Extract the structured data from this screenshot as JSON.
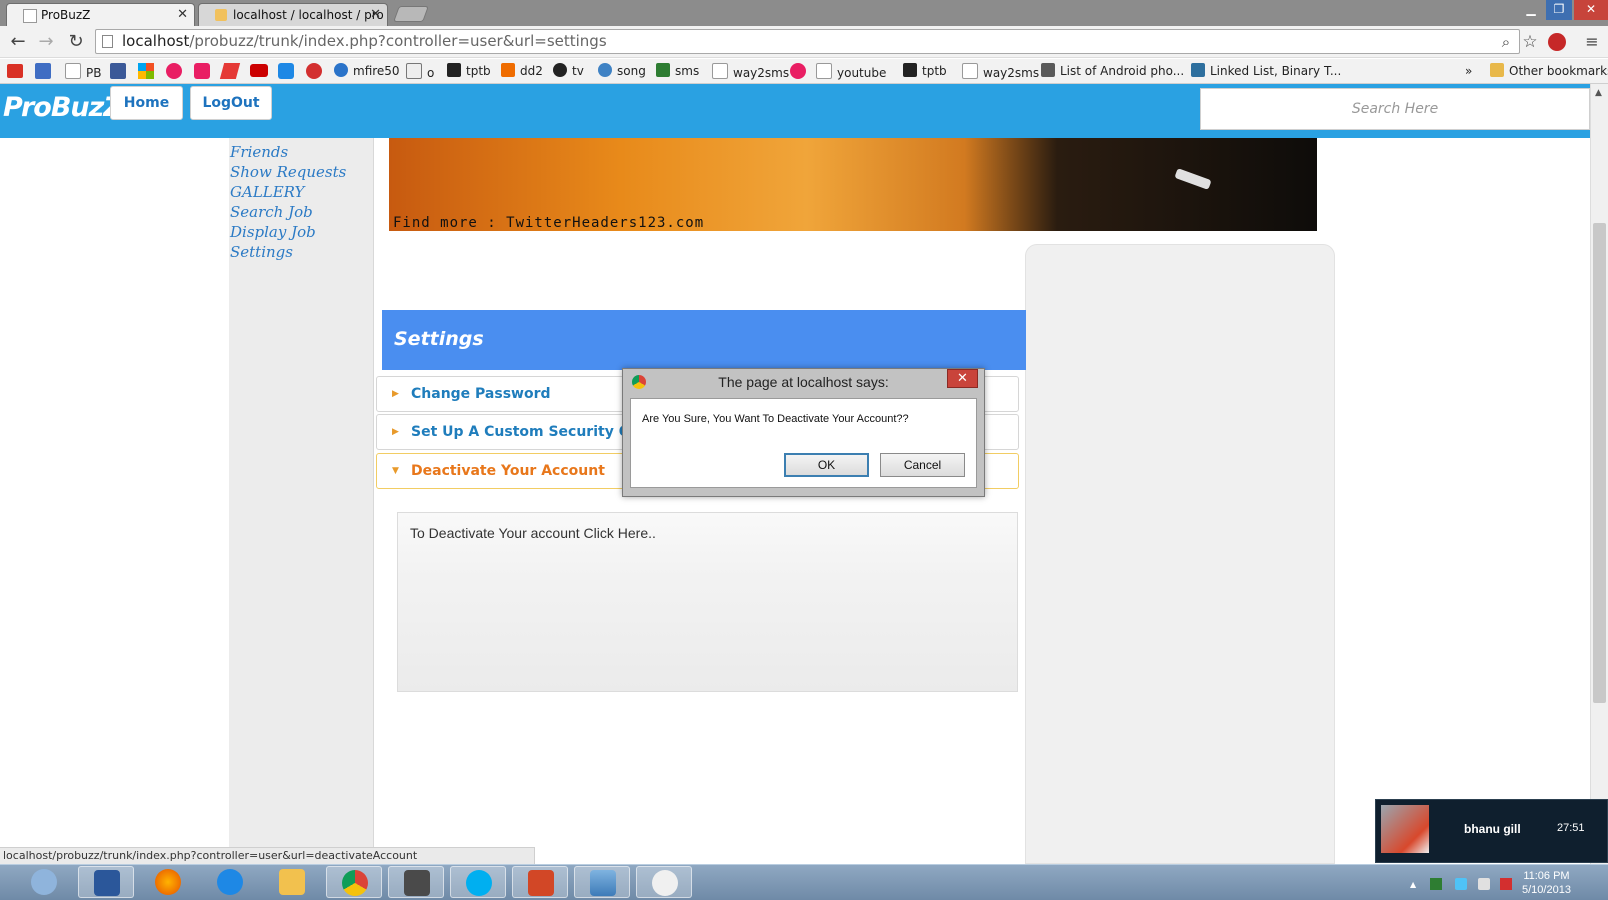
{
  "browser": {
    "tabs": [
      {
        "title": "ProBuzZ"
      },
      {
        "title": "localhost / localhost / pro"
      }
    ],
    "address": {
      "host": "localhost",
      "path": "/probuzz/trunk/index.php?controller=user&url=settings"
    },
    "status_url": "localhost/probuzz/trunk/index.php?controller=user&url=deactivateAccount",
    "bookmarks": [
      {
        "label": "PB",
        "color": "#9e9e9e"
      },
      {
        "label": "mfire50",
        "color": "#2a73c9"
      },
      {
        "label": "o",
        "color": "#777777"
      },
      {
        "label": "tptb",
        "color": "#222222"
      },
      {
        "label": "dd2",
        "color": "#ef6c00"
      },
      {
        "label": "tv",
        "color": "#222222"
      },
      {
        "label": "song",
        "color": "#3f82c4"
      },
      {
        "label": "sms",
        "color": "#2e7d32"
      },
      {
        "label": "way2sms",
        "color": "#9e9e9e"
      },
      {
        "label": "youtube",
        "color": "#9e9e9e"
      },
      {
        "label": "tptb",
        "color": "#222222"
      },
      {
        "label": "way2sms",
        "color": "#9e9e9e"
      },
      {
        "label": "List of Android pho...",
        "color": "#5a5a5a"
      },
      {
        "label": "Linked List, Binary T...",
        "color": "#2e6f9e"
      }
    ],
    "overflow": "»",
    "other_bookmarks": "Other bookmarks"
  },
  "site": {
    "logo": "ProBuzZ",
    "nav": {
      "home": "Home",
      "logout": "LogOut"
    },
    "search_placeholder": "Search Here",
    "sidebar": [
      "Friends",
      "Show Requests",
      "GALLERY",
      "Search Job",
      "Display Job",
      "Settings"
    ],
    "banner_text": "Find more : TwitterHeaders123.com",
    "settings_title": "Settings",
    "accordion": [
      {
        "label": "Change Password"
      },
      {
        "label": "Set Up A Custom Security Que"
      },
      {
        "label": "Deactivate Your Account"
      }
    ],
    "deactivate_text": "To Deactivate Your account Click Here.."
  },
  "dialog": {
    "title": "The page at localhost says:",
    "message": "Are You Sure, You Want To Deactivate Your Account??",
    "ok": "OK",
    "cancel": "Cancel"
  },
  "notification": {
    "name": "bhanu gill",
    "time": "27:51"
  },
  "taskbar": {
    "time": "11:06 PM",
    "date": "5/10/2013"
  }
}
